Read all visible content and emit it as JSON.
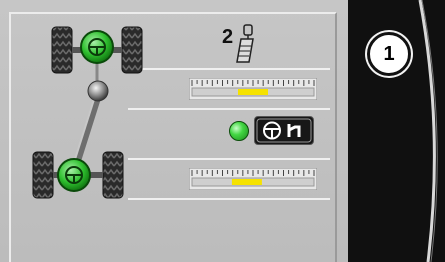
{
  "sensor": {
    "number": "2"
  },
  "page": {
    "badge": "1"
  },
  "front_axle": {
    "position_fraction": 0.5
  },
  "rear_axle": {
    "position_fraction": 0.45
  },
  "status_led": {
    "state": "on",
    "color": "#3ecb3e"
  },
  "steer_mode_button": {
    "icon": "steering-wheel-icon",
    "mode_icon": "steer-mode-icon"
  },
  "colors": {
    "indicator": "#f5e200",
    "wheel_green": "#2fc02f",
    "panel": "#c2c2c2"
  }
}
